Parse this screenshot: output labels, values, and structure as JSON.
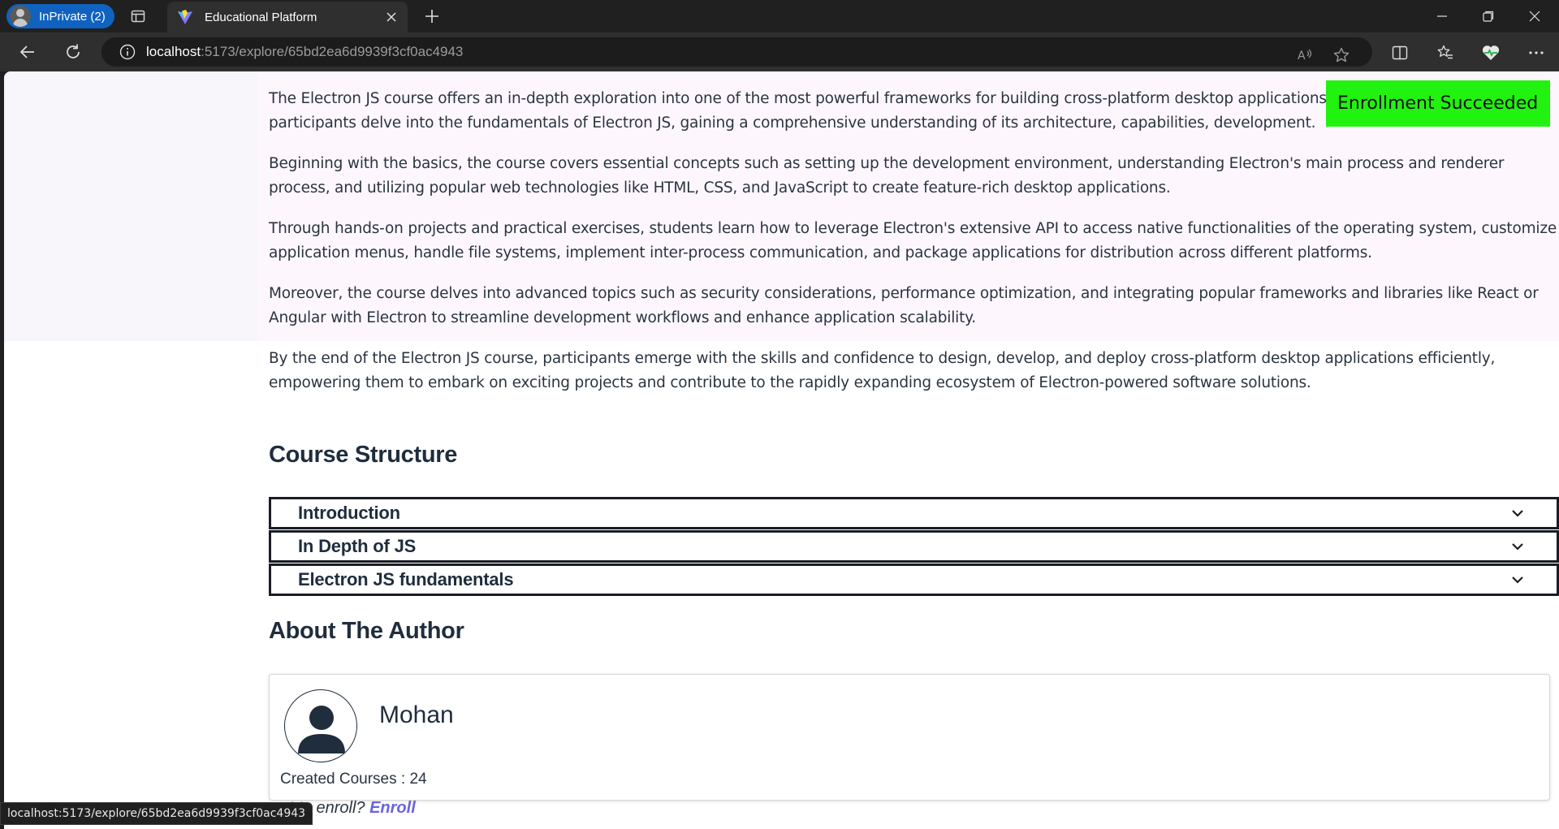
{
  "browser": {
    "profile_label": "InPrivate (2)",
    "tab_title": "Educational Platform",
    "url_host": "localhost",
    "url_rest": ":5173/explore/65bd2ea6d9939f3cf0ac4943",
    "status_url": "localhost:5173/explore/65bd2ea6d9939f3cf0ac4943"
  },
  "toast": {
    "message": "Enrollment Succeeded",
    "color": "#21f20f"
  },
  "course": {
    "description": [
      "The Electron JS course offers an in-depth exploration into one of the most powerful frameworks for building cross-platform desktop applications us span of the course, participants delve into the fundamentals of Electron JS, gaining a comprehensive understanding of its architecture, capabilities, development.",
      "Beginning with the basics, the course covers essential concepts such as setting up the development environment, understanding Electron's main process and renderer process, and utilizing popular web technologies like HTML, CSS, and JavaScript to create feature-rich desktop applications.",
      "Through hands-on projects and practical exercises, students learn how to leverage Electron's extensive API to access native functionalities of the operating system, customize application menus, handle file systems, implement inter-process communication, and package applications for distribution across different platforms.",
      "Moreover, the course delves into advanced topics such as security considerations, performance optimization, and integrating popular frameworks and libraries like React or Angular with Electron to streamline development workflows and enhance application scalability.",
      "By the end of the Electron JS course, participants emerge with the skills and confidence to design, develop, and deploy cross-platform desktop applications efficiently, empowering them to embark on exciting projects and contribute to the rapidly expanding ecosystem of Electron-powered software solutions."
    ],
    "structure_title": "Course Structure",
    "modules": [
      "Introduction",
      "In Depth of JS",
      "Electron JS fundamentals"
    ],
    "about_title": "About The Author",
    "author": {
      "name": "Mohan",
      "created_courses": "Created Courses : 24"
    },
    "enroll_prompt": "nt to enroll?",
    "enroll_link": "Enroll"
  }
}
